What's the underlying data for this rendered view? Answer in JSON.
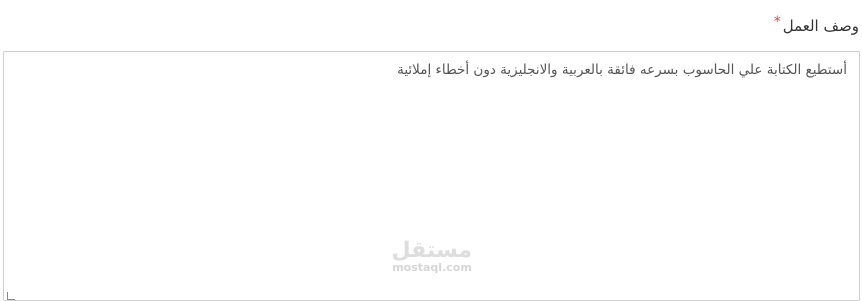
{
  "form": {
    "field_label": "وصف العمل",
    "required_mark": "*",
    "textarea_value": "أستطيع الكتابة علي الحاسوب بسرعه فائقة بالعربية والانجليزية دون أخطاء إملائية"
  },
  "watermark": {
    "arabic": "مستقل",
    "latin": "mostaql.com"
  }
}
